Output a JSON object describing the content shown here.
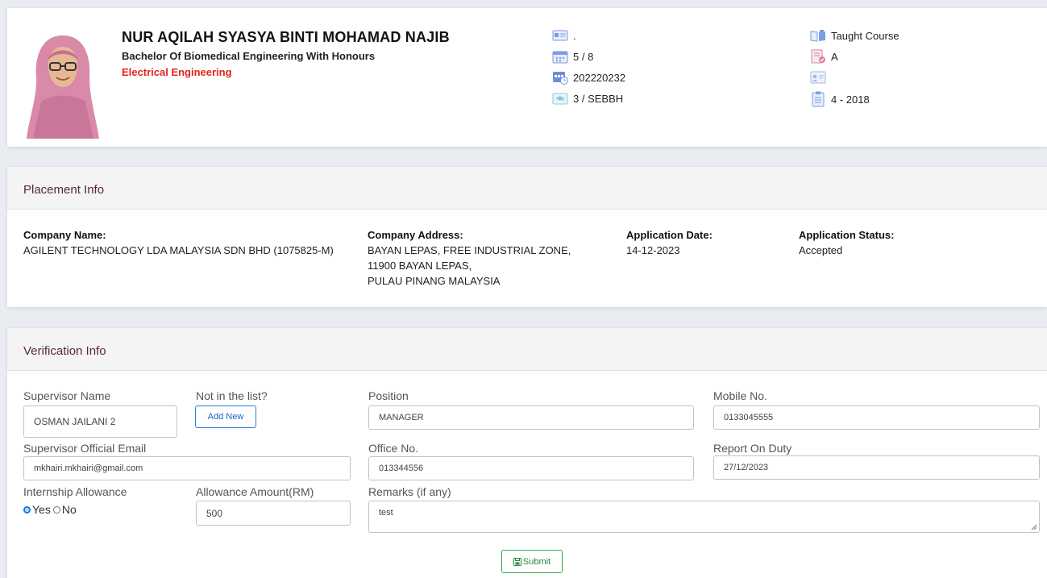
{
  "profile": {
    "name": "NUR AQILAH SYASYA BINTI MOHAMAD NAJIB",
    "degree": "Bachelor Of Biomedical Engineering With Honours",
    "department": "Electrical Engineering",
    "info_left": [
      ".",
      "5 / 8",
      "202220232",
      "3 / SEBBH"
    ],
    "info_right": [
      "Taught Course",
      "A",
      "",
      "4 - 2018"
    ]
  },
  "placement": {
    "title": "Placement Info",
    "company_name_label": "Company Name:",
    "company_name": "AGILENT TECHNOLOGY LDA MALAYSIA SDN BHD (1075825-M)",
    "company_address_label": "Company Address:",
    "company_address_lines": [
      "BAYAN LEPAS, FREE INDUSTRIAL ZONE,",
      "11900 BAYAN LEPAS,",
      "PULAU PINANG MALAYSIA"
    ],
    "application_date_label": "Application Date:",
    "application_date": "14-12-2023",
    "application_status_label": "Application Status:",
    "application_status": "Accepted"
  },
  "verification": {
    "title": "Verification Info",
    "supervisor_name_label": "Supervisor Name",
    "supervisor_name": "OSMAN JAILANI 2",
    "not_in_list_label": "Not in the list?",
    "add_new_label": "Add New",
    "position_label": "Position",
    "position": "MANAGER",
    "mobile_label": "Mobile No.",
    "mobile": "0133045555",
    "email_label": "Supervisor Official Email",
    "email": "mkhairi.mkhairi@gmail.com",
    "office_label": "Office No.",
    "office": "013344556",
    "report_label": "Report On Duty",
    "report": "27/12/2023",
    "allowance_label": "Internship Allowance",
    "allowance_yes": "Yes",
    "allowance_no": "No",
    "allowance_selected": "Yes",
    "amount_label": "Allowance Amount(RM)",
    "amount": "500",
    "remarks_label": "Remarks (if any)",
    "remarks": "test",
    "submit_label": "Submit"
  },
  "colors": {
    "accent": "#1a73e8",
    "department": "#e0261b",
    "submit": "#2aa84a",
    "icon": "#7a9ee0"
  }
}
